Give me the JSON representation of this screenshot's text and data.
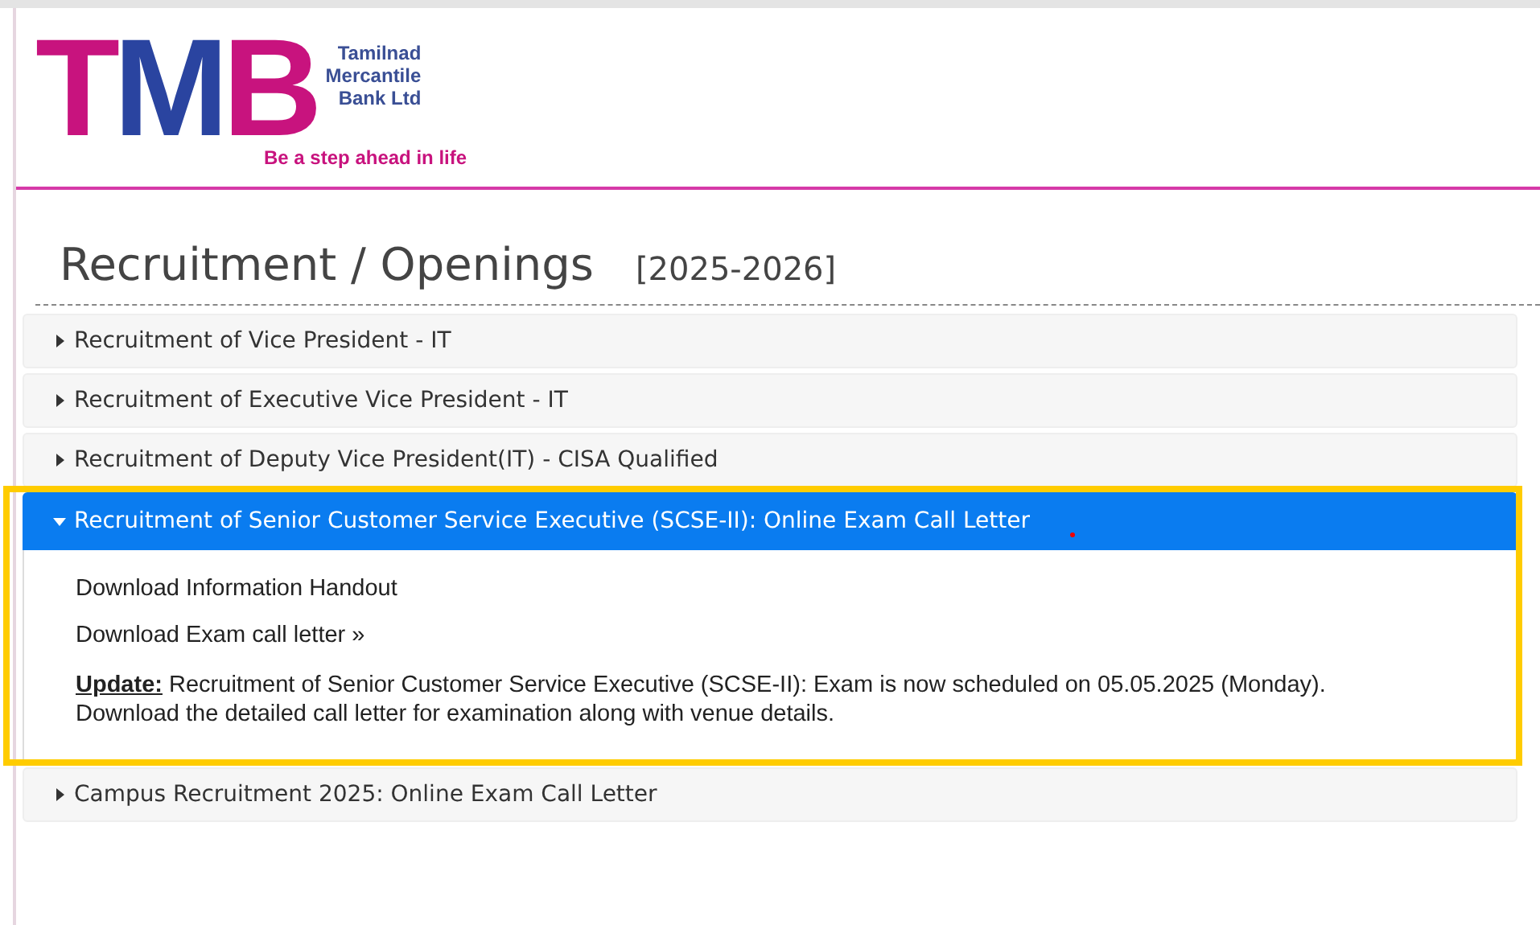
{
  "logo": {
    "mark": "TMB",
    "name_lines": [
      "Tamilnad",
      "Mercantile",
      "Bank Ltd"
    ],
    "tagline": "Be a step ahead in life"
  },
  "heading": {
    "title": "Recruitment / Openings",
    "period": "[2025-2026]"
  },
  "accordion": [
    {
      "title": "Recruitment of Vice President - IT",
      "expanded": false
    },
    {
      "title": "Recruitment of Executive Vice President - IT",
      "expanded": false
    },
    {
      "title": "Recruitment of Deputy Vice President(IT) - CISA Qualified",
      "expanded": false
    },
    {
      "title": "Recruitment of Senior Customer Service Executive (SCSE-II): Online Exam Call Letter",
      "expanded": true,
      "links": [
        "Download Information Handout",
        "Download Exam call letter »"
      ],
      "update": "**Update:** Recruitment of Senior Customer Service Executive (SCSE-II): Exam is now scheduled on 05.05.2025 (Monday). Download the detailed call letter for examination along with venue details."
    },
    {
      "title": "Campus Recruitment 2025: Online Exam Call Letter",
      "expanded": false
    }
  ]
}
